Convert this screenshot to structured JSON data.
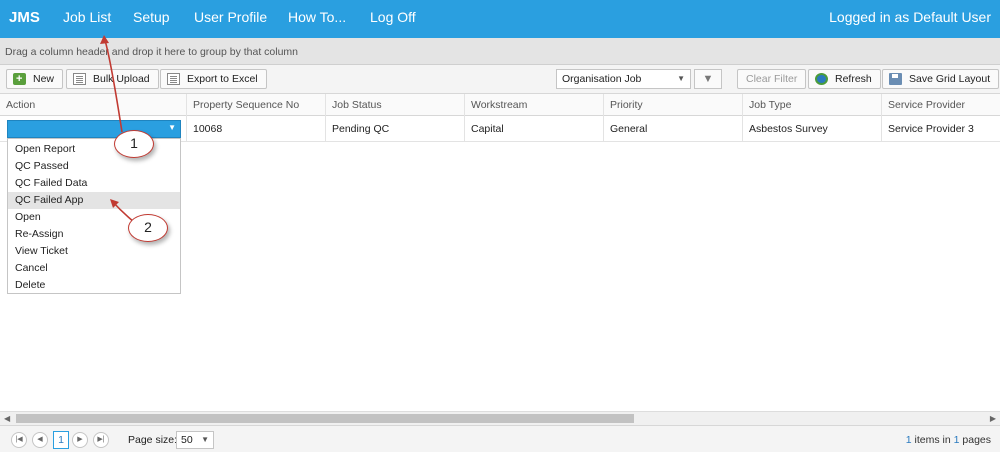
{
  "topbar": {
    "brand": "JMS",
    "nav": [
      "Job List",
      "Setup",
      "User Profile",
      "How To...",
      "Log Off"
    ],
    "logged_in": "Logged in as Default User"
  },
  "groupbar": {
    "text": "Drag a column header and drop it here to group by that column"
  },
  "toolbar": {
    "new": "New",
    "bulk_upload": "Bulk Upload",
    "export": "Export to Excel",
    "view_select": "Organisation Job",
    "clear_filter": "Clear Filter",
    "refresh": "Refresh",
    "save_layout": "Save Grid Layout"
  },
  "grid": {
    "columns": [
      "Action",
      "Property Sequence No",
      "Job Status",
      "Workstream",
      "Priority",
      "Job Type",
      "Service Provider"
    ],
    "row": {
      "property_sequence_no": "10068",
      "job_status": "Pending QC",
      "workstream": "Capital",
      "priority": "General",
      "job_type": "Asbestos Survey",
      "service_provider": "Service Provider 3"
    }
  },
  "action_menu": {
    "items": [
      "Open Report",
      "QC Passed",
      "QC Failed Data",
      "QC Failed App",
      "Open",
      "Re-Assign",
      "View Ticket",
      "Cancel",
      "Delete"
    ],
    "highlighted": "QC Failed App"
  },
  "pager": {
    "current_page": "1",
    "page_size_label": "Page size:",
    "page_size": "50",
    "items_count": "1",
    "items_mid": "items in",
    "pages_count": "1",
    "pages_label": "pages"
  },
  "callouts": [
    "1",
    "2"
  ],
  "colors": {
    "accent": "#2a9fe0",
    "callout_border": "#c13a32"
  }
}
